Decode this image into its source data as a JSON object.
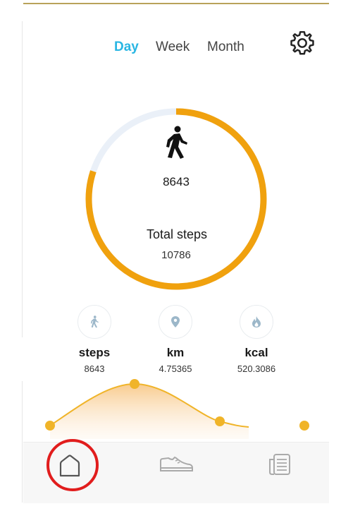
{
  "tabs": [
    {
      "label": "Day",
      "active": true
    },
    {
      "label": "Week",
      "active": false
    },
    {
      "label": "Month",
      "active": false
    }
  ],
  "icons": {
    "settings": "gear-icon",
    "walker": "walking-person-icon",
    "steps": "walking-person-icon",
    "distance": "location-pin-icon",
    "calories": "flame-icon",
    "home": "home-icon",
    "shoe": "sneaker-icon",
    "records": "document-list-icon"
  },
  "progress": {
    "current": "8643",
    "total_label": "Total steps",
    "total": "10786",
    "fraction": 0.801
  },
  "stats": [
    {
      "name": "steps",
      "value": "8643"
    },
    {
      "name": "km",
      "value": "4.75365"
    },
    {
      "name": "kcal",
      "value": "520.3086"
    }
  ],
  "colors": {
    "accent": "#f0a10e",
    "ring_track": "#eaf0f8",
    "active_tab": "#29b6e3",
    "icon_blue": "#9cb7c9",
    "curve": "#f0b429",
    "highlight": "#e11d1d"
  }
}
